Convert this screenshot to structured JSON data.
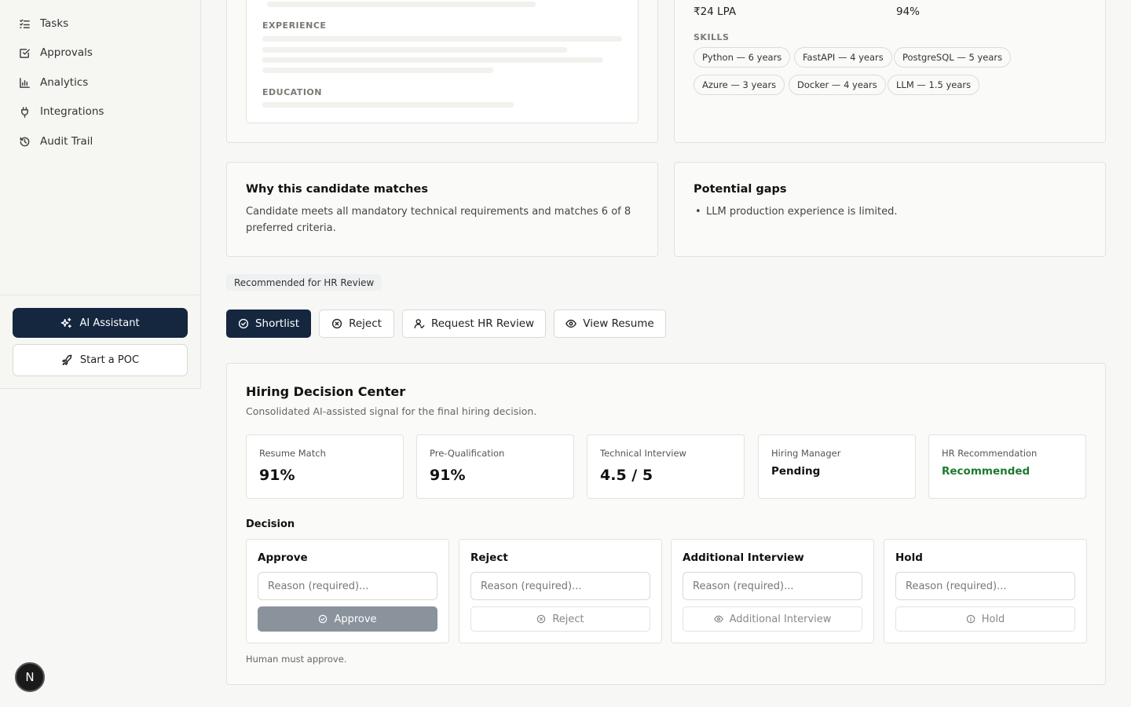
{
  "sidebar": {
    "items": [
      {
        "label": "Tasks",
        "icon": "list-check-icon"
      },
      {
        "label": "Approvals",
        "icon": "square-check-icon"
      },
      {
        "label": "Analytics",
        "icon": "bar-chart-icon"
      },
      {
        "label": "Integrations",
        "icon": "plug-icon"
      },
      {
        "label": "Audit Trail",
        "icon": "history-icon"
      }
    ],
    "ai_assistant": "AI Assistant",
    "start_poc": "Start a POC",
    "avatar_initial": "N"
  },
  "resume": {
    "experience_label": "EXPERIENCE",
    "education_label": "EDUCATION"
  },
  "profile": {
    "salary": "₹24 LPA",
    "score": "94%",
    "skills_label": "SKILLS",
    "skills": [
      "Python — 6 years",
      "FastAPI — 4 years",
      "PostgreSQL — 5 years",
      "Azure — 3 years",
      "Docker — 4 years",
      "LLM — 1.5 years"
    ]
  },
  "why": {
    "title": "Why this candidate matches",
    "line1": "Candidate meets all mandatory technical requirements and matches 6 of 8",
    "line2": "preferred criteria."
  },
  "gaps": {
    "title": "Potential gaps",
    "items": [
      "LLM production experience is limited."
    ]
  },
  "recommendation_badge": "Recommended for HR Review",
  "actions": {
    "shortlist": "Shortlist",
    "reject": "Reject",
    "request_hr": "Request HR Review",
    "view_resume": "View Resume"
  },
  "hdc": {
    "title": "Hiring Decision Center",
    "subtitle": "Consolidated AI-assisted signal for the final hiring decision.",
    "metrics": [
      {
        "label": "Resume Match",
        "value": "91%"
      },
      {
        "label": "Pre-Qualification",
        "value": "91%"
      },
      {
        "label": "Technical Interview",
        "value": "4.5 / 5"
      },
      {
        "label": "Hiring Manager",
        "value": "Pending"
      },
      {
        "label": "HR Recommendation",
        "value": "Recommended"
      }
    ],
    "decision_label": "Decision",
    "decisions": [
      {
        "title": "Approve",
        "placeholder": "Reason (required)...",
        "button": "Approve"
      },
      {
        "title": "Reject",
        "placeholder": "Reason (required)...",
        "button": "Reject"
      },
      {
        "title": "Additional Interview",
        "placeholder": "Reason (required)...",
        "button": "Additional Interview"
      },
      {
        "title": "Hold",
        "placeholder": "Reason (required)...",
        "button": "Hold"
      }
    ],
    "footnote": "Human must approve."
  },
  "colors": {
    "primary": "#15273f",
    "success": "#1c7a2f",
    "disabled_approve": "#8a939c"
  }
}
